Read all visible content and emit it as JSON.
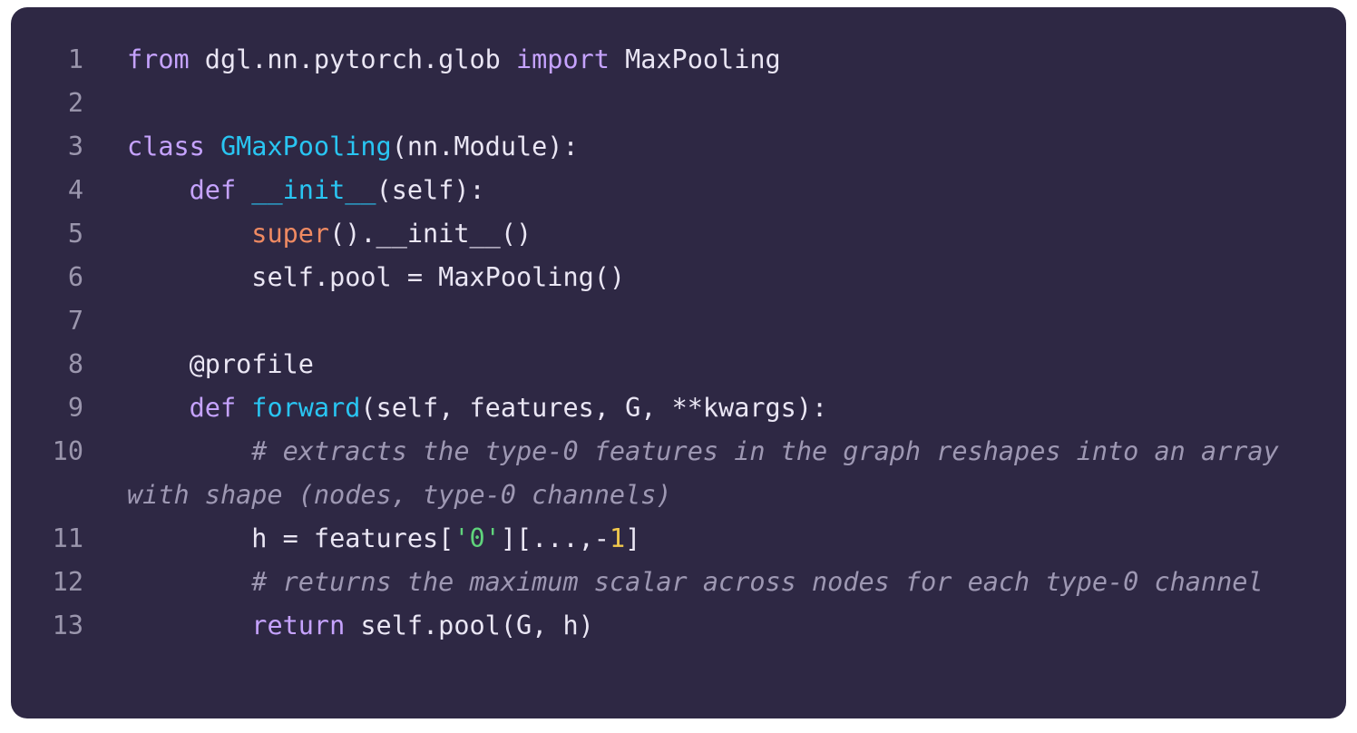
{
  "colors": {
    "background": "#2e2844",
    "keyword": "#c6a3ff",
    "function": "#29c5f2",
    "builtin": "#ef8a62",
    "comment": "#9e98b3",
    "string": "#5fd37b",
    "number": "#f2c94c",
    "line_number": "#9b96ad",
    "text": "#eae6f4"
  },
  "lines": [
    {
      "num": "1",
      "tokens": [
        [
          "kw",
          "from"
        ],
        [
          "pl",
          " dgl.nn.pytorch.glob "
        ],
        [
          "kw",
          "import"
        ],
        [
          "pl",
          " MaxPooling"
        ]
      ]
    },
    {
      "num": "2",
      "tokens": []
    },
    {
      "num": "3",
      "tokens": [
        [
          "kw",
          "class"
        ],
        [
          "pl",
          " "
        ],
        [
          "fn",
          "GMaxPooling"
        ],
        [
          "pl",
          "(nn.Module):"
        ]
      ]
    },
    {
      "num": "4",
      "tokens": [
        [
          "pl",
          "    "
        ],
        [
          "kw",
          "def"
        ],
        [
          "pl",
          " "
        ],
        [
          "fn",
          "__init__"
        ],
        [
          "pl",
          "(self):"
        ]
      ]
    },
    {
      "num": "5",
      "tokens": [
        [
          "pl",
          "        "
        ],
        [
          "bi",
          "super"
        ],
        [
          "pl",
          "().__init__()"
        ]
      ]
    },
    {
      "num": "6",
      "tokens": [
        [
          "pl",
          "        self.pool = MaxPooling()"
        ]
      ]
    },
    {
      "num": "7",
      "tokens": []
    },
    {
      "num": "8",
      "tokens": [
        [
          "pl",
          "    @profile"
        ]
      ]
    },
    {
      "num": "9",
      "tokens": [
        [
          "pl",
          "    "
        ],
        [
          "kw",
          "def"
        ],
        [
          "pl",
          " "
        ],
        [
          "fn",
          "forward"
        ],
        [
          "pl",
          "(self, features, G, **kwargs):"
        ]
      ]
    },
    {
      "num": "10",
      "tokens": [
        [
          "pl",
          "        "
        ],
        [
          "cm",
          "# extracts the type-0 features in the graph reshapes into an array with shape (nodes, type-0 channels)"
        ]
      ]
    },
    {
      "num": "11",
      "tokens": [
        [
          "pl",
          "        h = features["
        ],
        [
          "st",
          "'0'"
        ],
        [
          "pl",
          "][...,-"
        ],
        [
          "nu",
          "1"
        ],
        [
          "pl",
          "]"
        ]
      ]
    },
    {
      "num": "12",
      "tokens": [
        [
          "pl",
          "        "
        ],
        [
          "cm",
          "# returns the maximum scalar across nodes for each type-0 channel"
        ]
      ]
    },
    {
      "num": "13",
      "tokens": [
        [
          "pl",
          "        "
        ],
        [
          "kw",
          "return"
        ],
        [
          "pl",
          " self.pool(G, h)"
        ]
      ]
    }
  ]
}
